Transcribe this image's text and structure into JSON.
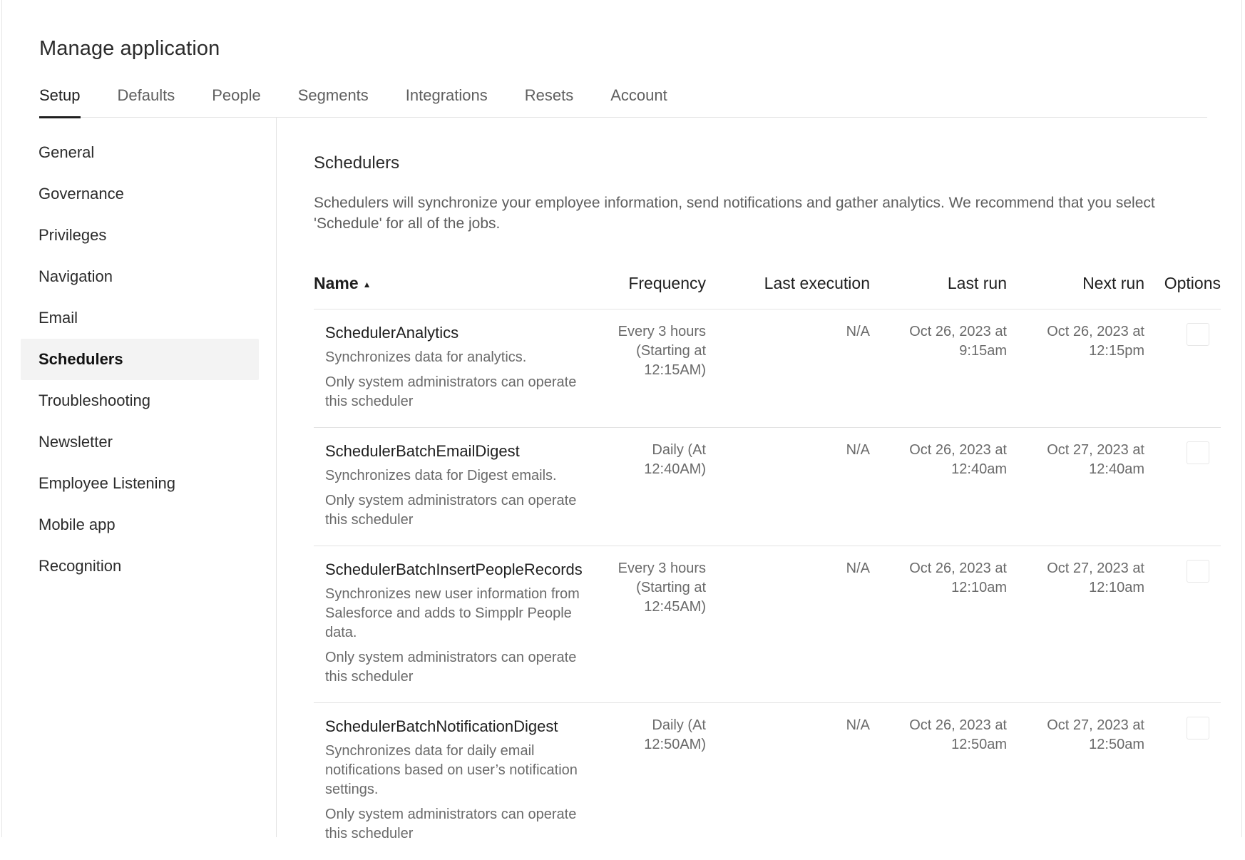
{
  "page": {
    "title": "Manage application"
  },
  "tabs": [
    {
      "label": "Setup",
      "active": true
    },
    {
      "label": "Defaults"
    },
    {
      "label": "People"
    },
    {
      "label": "Segments"
    },
    {
      "label": "Integrations"
    },
    {
      "label": "Resets"
    },
    {
      "label": "Account"
    }
  ],
  "sidebar": {
    "items": [
      {
        "label": "General"
      },
      {
        "label": "Governance"
      },
      {
        "label": "Privileges"
      },
      {
        "label": "Navigation"
      },
      {
        "label": "Email"
      },
      {
        "label": "Schedulers",
        "active": true
      },
      {
        "label": "Troubleshooting"
      },
      {
        "label": "Newsletter"
      },
      {
        "label": "Employee Listening"
      },
      {
        "label": "Mobile app"
      },
      {
        "label": "Recognition"
      }
    ]
  },
  "section": {
    "title": "Schedulers",
    "description": "Schedulers will synchronize your employee information, send notifications and gather analytics. We recommend that you select 'Schedule' for all of the jobs."
  },
  "table": {
    "headers": {
      "name": "Name",
      "sort_icon": "sort-ascending-icon",
      "frequency": "Frequency",
      "last_execution": "Last execution",
      "last_run": "Last run",
      "next_run": "Next run",
      "options": "Options"
    },
    "rows": [
      {
        "name": "SchedulerAnalytics",
        "description": "Synchronizes data for analytics.",
        "note": "Only system administrators can operate this scheduler",
        "frequency": "Every 3 hours (Starting at 12:15AM)",
        "last_execution": "N/A",
        "last_run": "Oct 26, 2023 at 9:15am",
        "next_run": "Oct 26, 2023 at 12:15pm"
      },
      {
        "name": "SchedulerBatchEmailDigest",
        "description": "Synchronizes data for Digest emails.",
        "note": "Only system administrators can operate this scheduler",
        "frequency": "Daily (At 12:40AM)",
        "last_execution": "N/A",
        "last_run": "Oct 26, 2023 at 12:40am",
        "next_run": "Oct 27, 2023 at 12:40am"
      },
      {
        "name": "SchedulerBatchInsertPeopleRecords",
        "description": "Synchronizes new user information from Salesforce and adds to Simpplr People data.",
        "note": "Only system administrators can operate this scheduler",
        "frequency": "Every 3 hours (Starting at 12:45AM)",
        "last_execution": "N/A",
        "last_run": "Oct 26, 2023 at 12:10am",
        "next_run": "Oct 27, 2023 at 12:10am"
      },
      {
        "name": "SchedulerBatchNotificationDigest",
        "description": "Synchronizes data for daily email notifications based on user’s notification settings.",
        "note": "Only system administrators can operate this scheduler",
        "frequency": "Daily (At 12:50AM)",
        "last_execution": "N/A",
        "last_run": "Oct 26, 2023 at 12:50am",
        "next_run": "Oct 27, 2023 at 12:50am"
      }
    ]
  }
}
